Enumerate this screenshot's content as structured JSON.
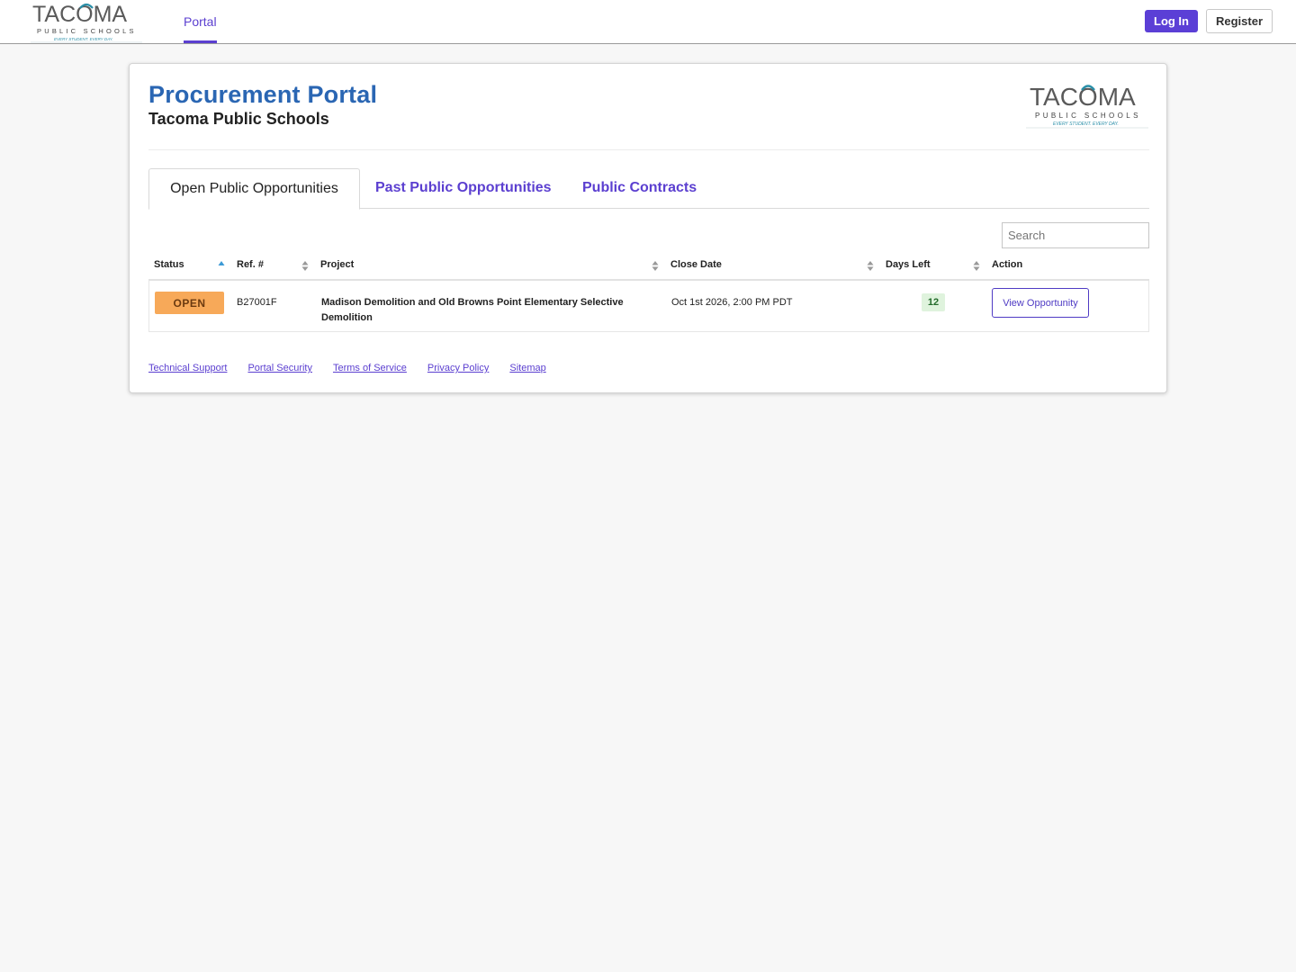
{
  "brand": {
    "name": "TACOMA",
    "sub": "PUBLIC SCHOOLS",
    "tagline": "EVERY STUDENT. EVERY DAY."
  },
  "nav": {
    "portal_label": "Portal",
    "login_label": "Log In",
    "register_label": "Register"
  },
  "card": {
    "title": "Procurement Portal",
    "subtitle": "Tacoma Public Schools"
  },
  "tabs": [
    {
      "label": "Open Public Opportunities",
      "active": true
    },
    {
      "label": "Past Public Opportunities",
      "active": false
    },
    {
      "label": "Public Contracts",
      "active": false
    }
  ],
  "search": {
    "placeholder": "Search",
    "value": ""
  },
  "table": {
    "columns": [
      "Status",
      "Ref. #",
      "Project",
      "Close Date",
      "Days Left",
      "Action"
    ],
    "rows": [
      {
        "status": "OPEN",
        "ref": "B27001F",
        "project": "Madison Demolition and Old Browns Point Elementary Selective Demolition",
        "close_date": "Oct 1st 2026, 2:00 PM PDT",
        "days_left": "12",
        "action": "View Opportunity"
      }
    ]
  },
  "footer": {
    "links": [
      "Technical Support",
      "Portal Security",
      "Terms of Service",
      "Privacy Policy",
      "Sitemap"
    ]
  },
  "colors": {
    "accent": "#5b3fd0",
    "title_blue": "#2a66b3",
    "open_badge": "#f7a959",
    "days_badge": "#dff3dd",
    "logo_gray": "#5a5a5a",
    "logo_teal": "#2a8fa8"
  }
}
